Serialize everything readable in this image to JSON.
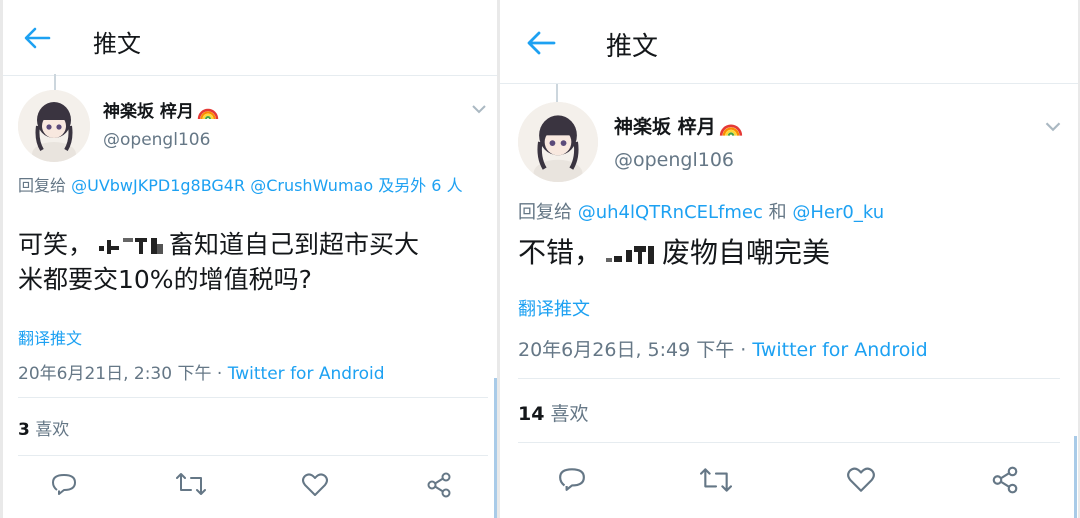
{
  "panels": [
    {
      "header_title": "推文",
      "display_name": "神楽坂 梓月",
      "handle": "@opengl106",
      "reply_prefix": "回复给",
      "reply_mentions": [
        "@UVbwJKPD1g8BG4R",
        "@CrushWumao"
      ],
      "reply_suffix": "及另外 6 人",
      "tweet_before": "可笑，",
      "tweet_after_line1": "畜知道自己到超市买大",
      "tweet_line2": "米都要交10%的增值税吗?",
      "translate": "翻译推文",
      "timestamp": "20年6月21日, 2:30 下午 · ",
      "source": "Twitter for Android",
      "like_count": "3",
      "like_label": "喜欢"
    },
    {
      "header_title": "推文",
      "display_name": "神楽坂 梓月",
      "handle": "@opengl106",
      "reply_prefix": "回复给",
      "reply_mentions": [
        "@uh4lQTRnCELfmec",
        "@Her0_ku"
      ],
      "reply_join": "和",
      "tweet_before": "不错，",
      "tweet_after": "废物自嘲完美",
      "translate": "翻译推文",
      "timestamp": "20年6月26日, 5:49 下午 · ",
      "source": "Twitter for Android",
      "like_count": "14",
      "like_label": "喜欢"
    }
  ],
  "icons": {
    "back": "arrow-left-icon",
    "more": "chevron-down-icon",
    "reply": "comment-icon",
    "retweet": "retweet-icon",
    "like": "heart-icon",
    "share": "share-icon",
    "rainbow": "rainbow-emoji"
  },
  "colors": {
    "accent": "#1da1f2",
    "secondary_text": "#657786",
    "divider": "#e6ecf0"
  }
}
